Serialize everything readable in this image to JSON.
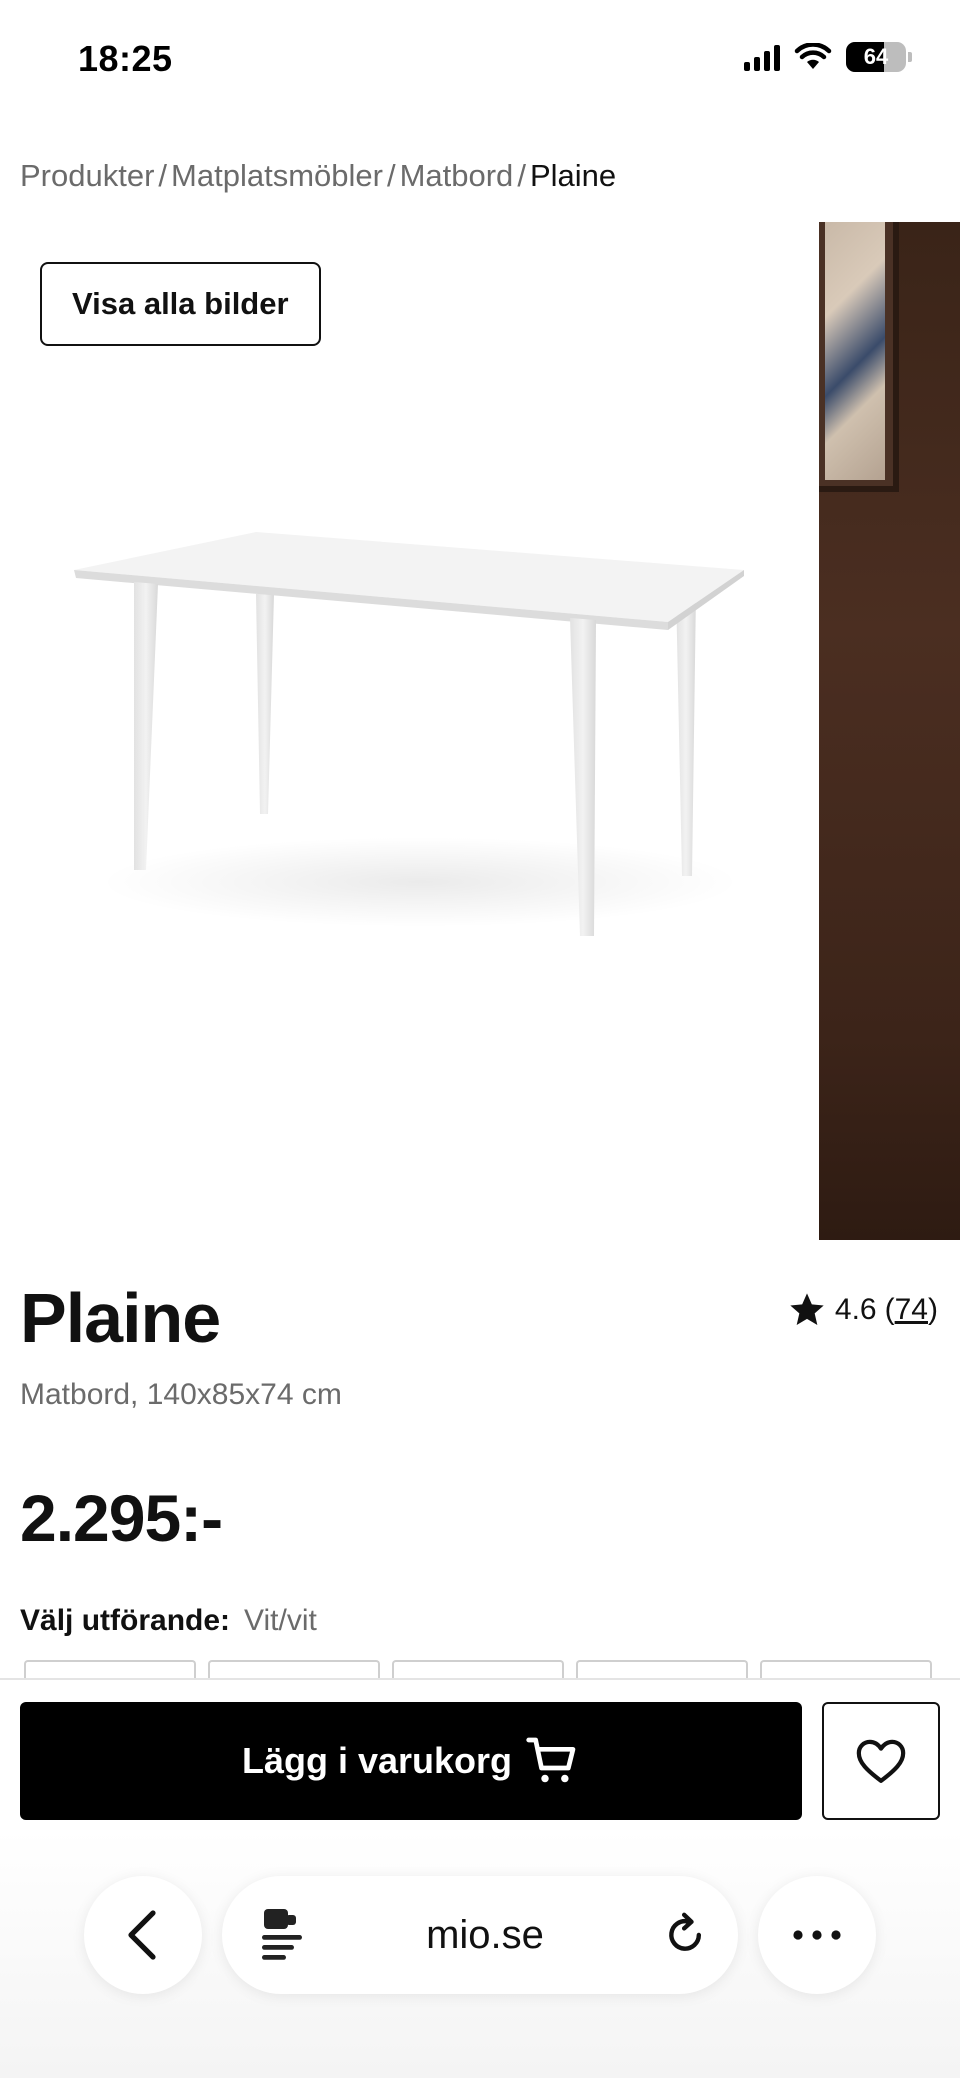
{
  "status_bar": {
    "time": "18:25",
    "battery": "64",
    "battery_level": 0.64
  },
  "breadcrumb": {
    "items": [
      "Produkter",
      "Matplatsmöbler",
      "Matbord"
    ],
    "separator": "/",
    "current": "Plaine"
  },
  "gallery": {
    "view_all_label": "Visa alla bilder"
  },
  "product": {
    "title": "Plaine",
    "subtitle": "Matbord, 140x85x74 cm",
    "rating": "4.6",
    "review_count": "74",
    "price": "2.295:-",
    "variant_label": "Välj utförande:",
    "variant_value": "Vit/vit"
  },
  "actions": {
    "add_to_cart_label": "Lägg i varukorg"
  },
  "browser": {
    "url": "mio.se"
  },
  "icons": {
    "back": "chevron-left-icon",
    "page_menu": "page-menu-icon",
    "reload": "reload-icon",
    "more": "more-icon",
    "cart": "cart-icon",
    "heart": "heart-icon",
    "star": "star-icon"
  },
  "colors": {
    "primary_button": "#000000",
    "text": "#111111",
    "muted_text": "#6b6b6b"
  }
}
